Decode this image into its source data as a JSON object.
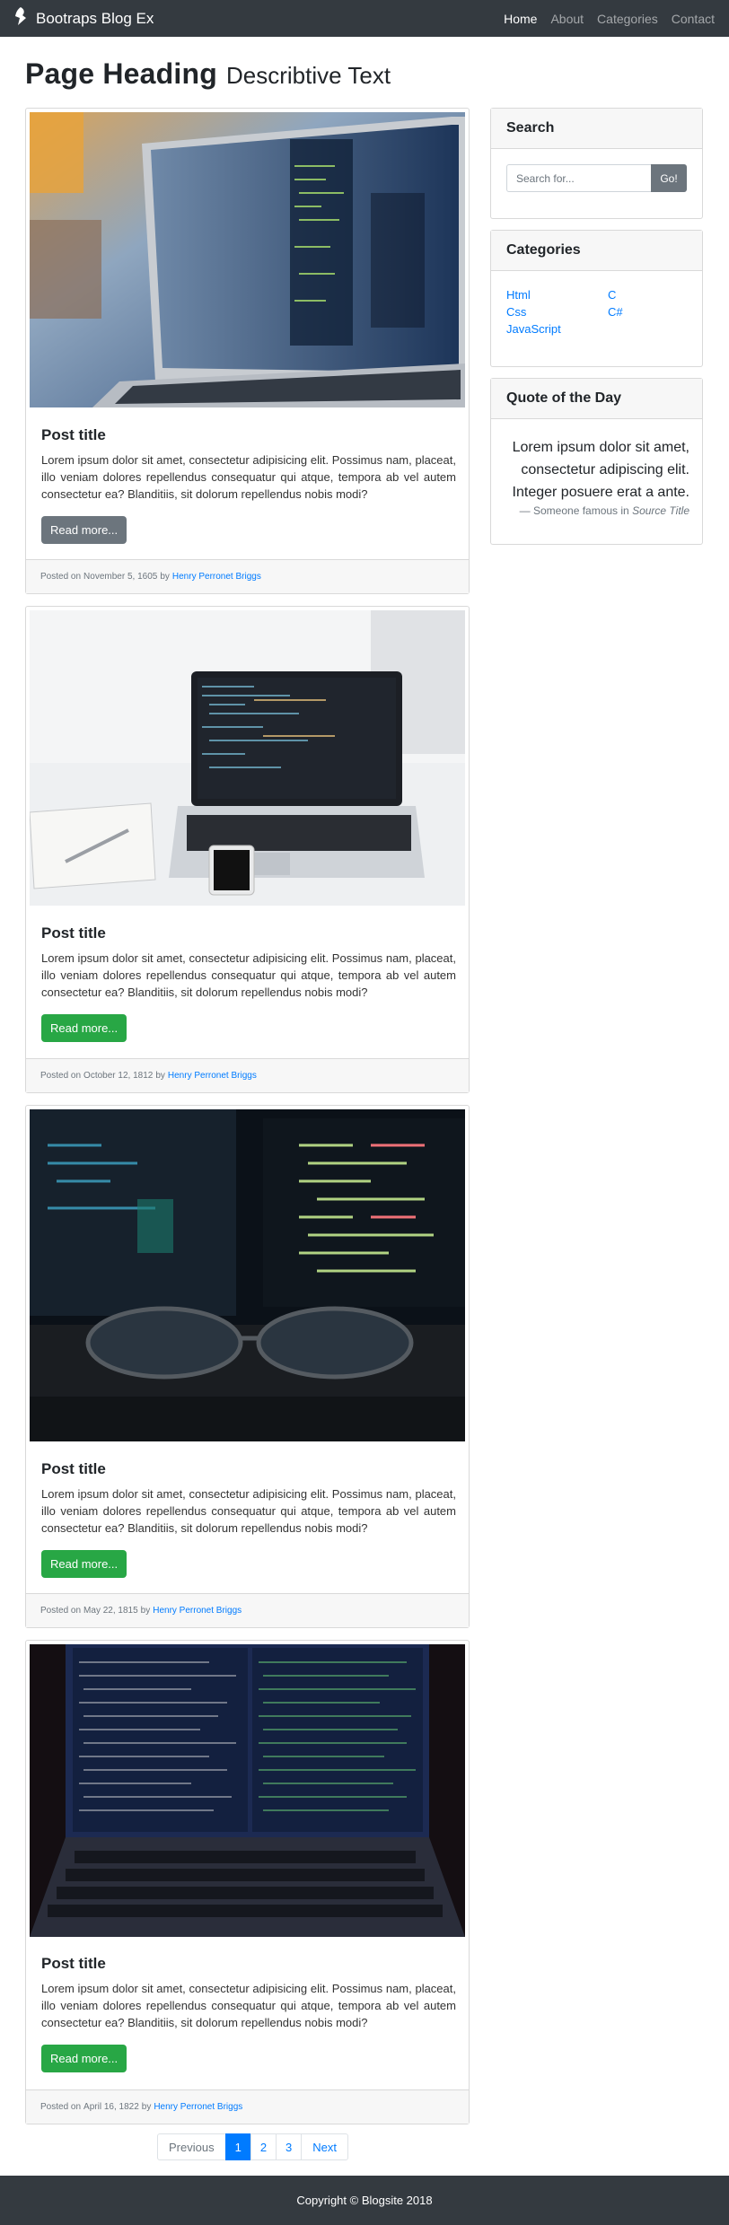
{
  "navbar": {
    "brand": "Bootraps Blog Ex",
    "links": [
      {
        "label": "Home",
        "active": true
      },
      {
        "label": "About"
      },
      {
        "label": "Categories"
      },
      {
        "label": "Contact"
      }
    ]
  },
  "heading": {
    "title": "Page Heading",
    "subtitle": "Describtive Text"
  },
  "posts": [
    {
      "image": "laptop-code-photo",
      "title": "Post title",
      "text": "Lorem ipsum dolor sit amet, consectetur adipisicing elit. Possimus nam, placeat, illo veniam dolores repellendus consequatur qui atque, tempora ab vel autem consectetur ea? Blanditiis, sit dolorum repellendus nobis modi?",
      "button": "Read more...",
      "posted_prefix": "Posted on",
      "date": "November 5, 1605",
      "by": "by",
      "author": "Henry Perronet Briggs"
    },
    {
      "image": "laptop-desk-photo",
      "title": "Post title",
      "text": "Lorem ipsum dolor sit amet, consectetur adipisicing elit. Possimus nam, placeat, illo veniam dolores repellendus consequatur qui atque, tempora ab vel autem consectetur ea? Blanditiis, sit dolorum repellendus nobis modi?",
      "button": "Read more...",
      "posted_prefix": "Posted on",
      "date": "October 12, 1812",
      "by": "by",
      "author": "Henry Perronet Briggs"
    },
    {
      "image": "glasses-monitor-photo",
      "title": "Post title",
      "text": "Lorem ipsum dolor sit amet, consectetur adipisicing elit. Possimus nam, placeat, illo veniam dolores repellendus consequatur qui atque, tempora ab vel autem consectetur ea? Blanditiis, sit dolorum repellendus nobis modi?",
      "button": "Read more...",
      "posted_prefix": "Posted on",
      "date": "May 22, 1815",
      "by": "by",
      "author": "Henry Perronet Briggs"
    },
    {
      "image": "laptop-screen-code-photo",
      "title": "Post title",
      "text": "Lorem ipsum dolor sit amet, consectetur adipisicing elit. Possimus nam, placeat, illo veniam dolores repellendus consequatur qui atque, tempora ab vel autem consectetur ea? Blanditiis, sit dolorum repellendus nobis modi?",
      "button": "Read more...",
      "posted_prefix": "Posted on",
      "date": "April 16, 1822",
      "by": "by",
      "author": "Henry Perronet Briggs"
    }
  ],
  "sidebar": {
    "search": {
      "title": "Search",
      "placeholder": "Search for...",
      "button": "Go!"
    },
    "categories": {
      "title": "Categories",
      "items": [
        "Html",
        "C",
        "Css",
        "C#",
        "JavaScript"
      ]
    },
    "quote": {
      "title": "Quote of the Day",
      "text": "Lorem ipsum dolor sit amet, consectetur adipiscing elit. Integer posuere erat a ante.",
      "footer_prefix": "— Someone famous in",
      "source": "Source Title"
    }
  },
  "pagination": {
    "previous": "Previous",
    "pages": [
      "1",
      "2",
      "3"
    ],
    "active": "1",
    "next": "Next"
  },
  "footer": {
    "copyright": "Copyright © Blogsite 2018"
  },
  "colors": {
    "navbar": "#343a40",
    "link": "#007bff",
    "green": "#28a745",
    "grey": "#6c757d"
  }
}
